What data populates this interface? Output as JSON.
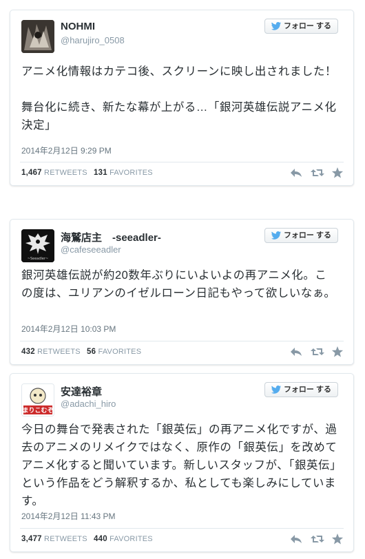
{
  "tweets": [
    {
      "name": "NOHMI",
      "handle": "@harujiro_0508",
      "follow_label": "フォロー する",
      "text": "アニメ化情報はカテコ後、スクリーンに映し出されました！\n\n舞台化に続き、新たな幕が上がる…「銀河英雄伝説アニメ化決定」",
      "date": "2014年2月12日 9:29 PM",
      "retweets": "1,467",
      "retweets_label": "RETWEETS",
      "favorites": "131",
      "favorites_label": "FAVORITES"
    },
    {
      "name": "海鷲店主　-seeadler-",
      "handle": "@cafeseeadler",
      "follow_label": "フォロー する",
      "text": "銀河英雄伝説が約20数年ぶりにいよいよの再アニメ化。この度は、ユリアンのイゼルローン日記もやって欲しいなぁ。",
      "date": "2014年2月12日 10:03 PM",
      "retweets": "432",
      "retweets_label": "RETWEETS",
      "favorites": "56",
      "favorites_label": "FAVORITES",
      "avatar_text": "海 鷲\n~ Seeadler ~"
    },
    {
      "name": "安達裕章",
      "handle": "@adachi_hiro",
      "follow_label": "フォロー する",
      "text": "今日の舞台で発表された「銀英伝」の再アニメ化ですが、過去のアニメのリメイクではなく、原作の「銀英伝」を改めてアニメ化すると聞いています。新しいスタッフが、「銀英伝」という作品をどう解釈するか、私としても楽しみにしています。",
      "date": "2014年2月12日 11:43 PM",
      "retweets": "3,477",
      "retweets_label": "RETWEETS",
      "favorites": "440",
      "favorites_label": "FAVORITES",
      "avatar_text": "まりこむぞ"
    }
  ],
  "colors": {
    "twitter_blue": "#55acee",
    "action_gray": "#8899a6",
    "border": "#e1e8ed"
  },
  "icons": [
    "twitter-bird-icon",
    "reply-icon",
    "retweet-icon",
    "favorite-star-icon"
  ]
}
